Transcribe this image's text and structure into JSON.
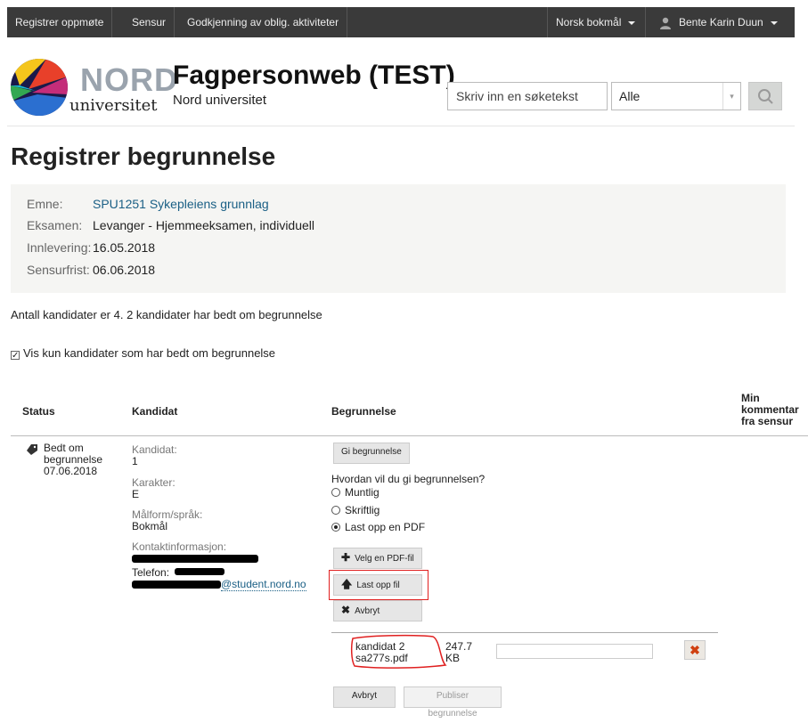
{
  "topbar": {
    "nav": [
      "Registrer oppmøte",
      "Sensur",
      "Godkjenning av oblig. aktiviteter"
    ],
    "language": "Norsk bokmål",
    "user": "Bente Karin Duun"
  },
  "header": {
    "logo_word": "NORD",
    "logo_sub": "universitet",
    "title": "Fagpersonweb (TEST)",
    "subtitle": "Nord universitet",
    "search_placeholder": "Skriv inn en søketekst",
    "filter_value": "Alle"
  },
  "page_title": "Registrer begrunnelse",
  "info": {
    "emne_label": "Emne:",
    "emne_value": "SPU1251 Sykepleiens grunnlag",
    "eksamen_label": "Eksamen:",
    "eksamen_value": "Levanger - Hjemmeeksamen, individuell",
    "innlevering_label": "Innlevering:",
    "innlevering_value": "16.05.2018",
    "sensurfrist_label": "Sensurfrist:",
    "sensurfrist_value": "06.06.2018"
  },
  "count_text": "Antall kandidater er 4. 2 kandidater har bedt om begrunnelse",
  "filter_label": "Vis kun kandidater som har bedt om begrunnelse",
  "table": {
    "headers": {
      "status": "Status",
      "kandidat": "Kandidat",
      "begrunnelse": "Begrunnelse",
      "kommentar": "Min kommentar fra sensur"
    },
    "row": {
      "status_l1": "Bedt om",
      "status_l2": "begrunnelse",
      "status_date": "07.06.2018",
      "kandidat_label": "Kandidat:",
      "kandidat_value": "1",
      "karakter_label": "Karakter:",
      "karakter_value": "E",
      "malform_label": "Målform/språk:",
      "malform_value": "Bokmål",
      "kontakt_label": "Kontaktinformasjon:",
      "telefon_label": "Telefon:",
      "email_suffix": "@student.nord.no",
      "gi_button": "Gi begrunnelse",
      "question": "Hvordan vil du gi begrunnelsen?",
      "options": [
        "Muntlig",
        "Skriftlig",
        "Last opp en PDF"
      ],
      "selected_option": 2,
      "velg_button": "Velg en PDF-fil",
      "last_opp_button": "Last opp fil",
      "avbryt_small": "Avbryt",
      "file_name_l1": "kandidat 2",
      "file_name_l2": "sa277s.pdf",
      "file_size_l1": "247.7",
      "file_size_l2": "KB",
      "avbryt_button": "Avbryt",
      "publiser_button": "Publiser begrunnelse"
    }
  }
}
